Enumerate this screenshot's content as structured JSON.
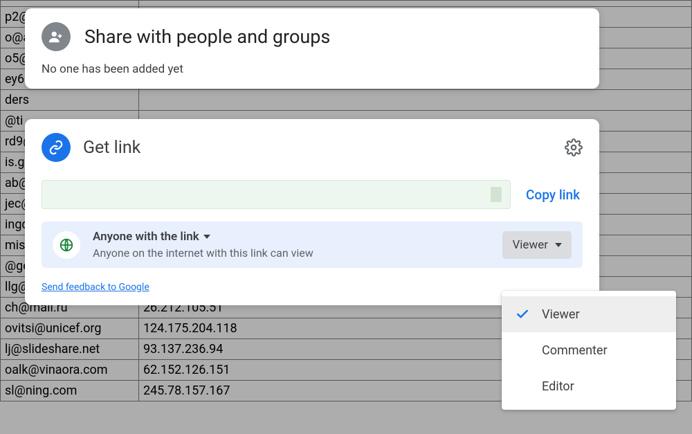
{
  "bg_rows": [
    [
      "",
      ""
    ],
    [
      "p2@",
      ""
    ],
    [
      "o@a",
      ""
    ],
    [
      "o5@",
      ""
    ],
    [
      "ey6@",
      ""
    ],
    [
      "ders",
      ""
    ],
    [
      "@ti",
      ""
    ],
    [
      "rd9@",
      ""
    ],
    [
      "is.g",
      ""
    ],
    [
      "ab@",
      ""
    ],
    [
      "jec@",
      ""
    ],
    [
      "ingd",
      ""
    ],
    [
      "misl",
      ""
    ],
    [
      "@ge",
      ""
    ],
    [
      "llg@",
      ""
    ],
    [
      "ch@mail.ru",
      "26.212.105.51"
    ],
    [
      "ovitsi@unicef.org",
      "124.175.204.118"
    ],
    [
      "lj@slideshare.net",
      "93.137.236.94"
    ],
    [
      "oalk@vinaora.com",
      "62.152.126.151"
    ],
    [
      "sl@ning.com",
      "245.78.157.167"
    ]
  ],
  "share": {
    "title": "Share with people and groups",
    "subtitle": "No one has been added yet"
  },
  "getlink": {
    "title": "Get link",
    "copy_button": "Copy link",
    "scope_label": "Anyone with the link",
    "scope_desc": "Anyone on the internet with this link can view",
    "role_button": "Viewer",
    "feedback": "Send feedback to Google"
  },
  "role_menu": {
    "options": [
      {
        "label": "Viewer",
        "selected": true
      },
      {
        "label": "Commenter",
        "selected": false
      },
      {
        "label": "Editor",
        "selected": false
      }
    ]
  }
}
